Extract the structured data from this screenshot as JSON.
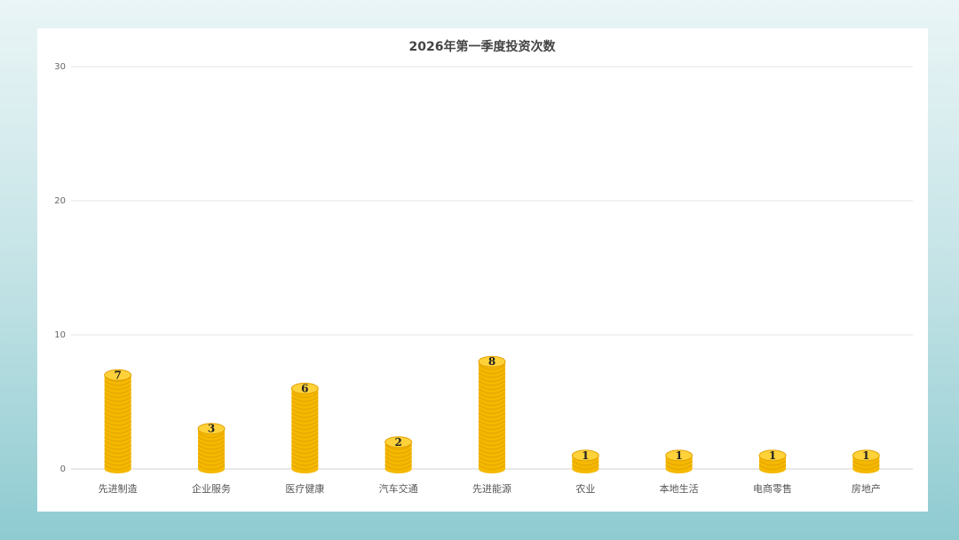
{
  "chart_data": {
    "type": "bar",
    "title": "2026年第一季度投资次数",
    "xlabel": "",
    "ylabel": "",
    "ylim": [
      0,
      30
    ],
    "yticks": [
      0,
      10,
      20,
      30
    ],
    "grid": true,
    "categories": [
      "先进制造",
      "企业服务",
      "医疗健康",
      "汽车交通",
      "先进能源",
      "农业",
      "本地生活",
      "电商零售",
      "房地产"
    ],
    "values": [
      7,
      3,
      6,
      2,
      8,
      1,
      1,
      1,
      1
    ],
    "bar_style": "coin-stack",
    "colors": {
      "coin": "#f5b800",
      "coin_edge": "#e0a100",
      "coin_top": "#ffd23a",
      "grid": "#e6e6e6",
      "axis": "#d0d0d0"
    }
  }
}
